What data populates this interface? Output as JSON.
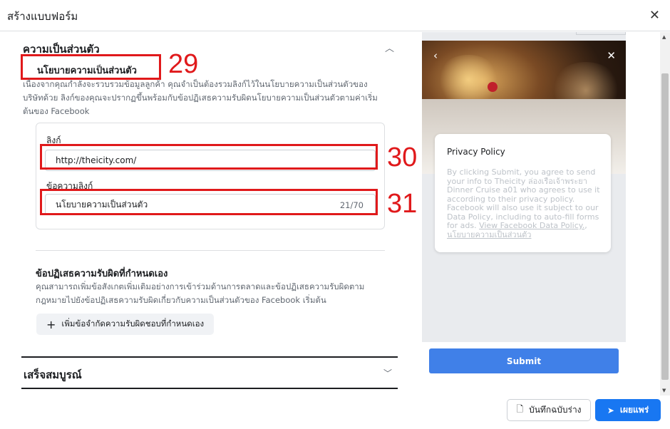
{
  "dialog": {
    "title": "สร้างแบบฟอร์ม",
    "close_icon": "close-icon"
  },
  "privacy_section": {
    "title": "ความเป็นส่วนตัว",
    "policy_title": "นโยบายความเป็นส่วนตัว",
    "policy_desc": "เนื่องจากคุณกำลังจะรวบรวมข้อมูลลูกค้า คุณจำเป็นต้องรวมลิงก์ไว้ในนโยบายความเป็นส่วนตัวของบริษัทด้วย ลิงก์ของคุณจะปรากฏขึ้นพร้อมกับข้อปฏิเสธความรับผิดนโยบายความเป็นส่วนตัวตามค่าเริ่มต้นของ Facebook",
    "link_label": "ลิงก์",
    "link_value": "http://theicity.com/",
    "link_text_label": "ข้อความลิงก์",
    "link_text_value": "นโยบายความเป็นส่วนตัว",
    "link_text_count": "21/70"
  },
  "disclaimer": {
    "title": "ข้อปฏิเสธความรับผิดที่กำหนดเอง",
    "desc": "คุณสามารถเพิ่มข้อสังเกตเพิ่มเติมอย่างการเข้าร่วมด้านการตลาดและข้อปฏิเสธความรับผิดตามกฎหมายไปยังข้อปฏิเสธความรับผิดเกี่ยวกับความเป็นส่วนตัวของ Facebook เริ่มต้น",
    "add_button": "เพิ่มข้อจำกัดความรับผิดชอบที่กำหนดเอง"
  },
  "complete_section": {
    "title": "เสร็จสมบูรณ์"
  },
  "annotations": [
    "29",
    "30",
    "31"
  ],
  "preview": {
    "card_title": "Privacy Policy",
    "card_text": "By clicking Submit, you agree to send your info to Theicity ล่องเรือเจ้าพระยา Dinner Cruise a01 who agrees to use it according to their privacy policy. Facebook will also use it subject to our Data Policy, including to auto-fill forms for ads.",
    "link1": "View Facebook Data Policy.",
    "link2": "นโยบายความเป็นส่วนตัว",
    "submit": "Submit"
  },
  "footer": {
    "save_draft": "บันทึกฉบับร่าง",
    "publish": "เผยแพร่"
  },
  "colors": {
    "annotation": "#e0191b",
    "primary": "#1877f2",
    "submit": "#4080e8"
  }
}
